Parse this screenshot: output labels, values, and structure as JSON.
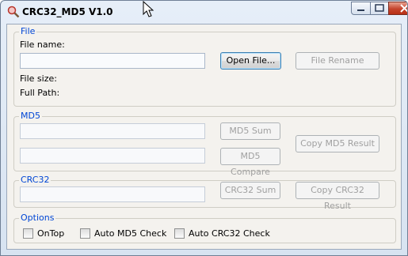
{
  "window": {
    "title": "CRC32_MD5 V1.0",
    "icon": "magnifier-icon"
  },
  "file_group": {
    "legend": "File",
    "file_name_label": "File name:",
    "file_name_value": "",
    "open_file_button": "Open File...",
    "file_rename_button": "File Rename",
    "file_size_label": "File size:",
    "full_path_label": "Full Path:"
  },
  "md5_group": {
    "legend": "MD5",
    "md5_sum_button": "MD5 Sum",
    "md5_compare_button": "MD5 Compare",
    "copy_md5_button": "Copy MD5 Result"
  },
  "crc32_group": {
    "legend": "CRC32",
    "crc32_sum_button": "CRC32 Sum",
    "copy_crc32_button": "Copy CRC32 Result"
  },
  "options_group": {
    "legend": "Options",
    "ontop_label": "OnTop",
    "ontop_checked": false,
    "auto_md5_label": "Auto MD5 Check",
    "auto_md5_checked": false,
    "auto_crc32_label": "Auto CRC32 Check",
    "auto_crc32_checked": false
  },
  "colors": {
    "legend_text": "#0046d5",
    "window_bg": "#f4f2ee",
    "close_button": "#c5432c"
  }
}
